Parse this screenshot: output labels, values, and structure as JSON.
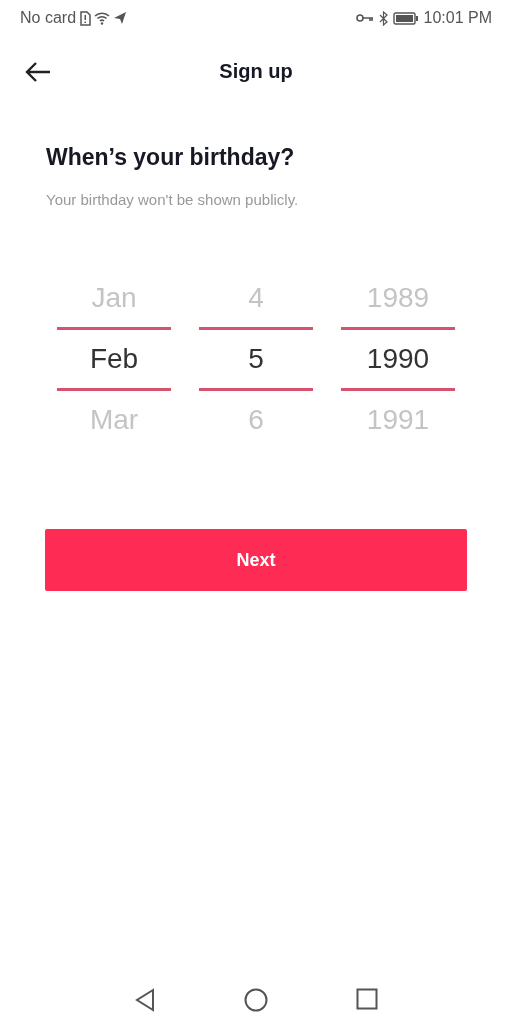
{
  "status_bar": {
    "carrier": "No card",
    "time": "10:01 PM"
  },
  "header": {
    "title": "Sign up"
  },
  "heading": "When’s your birthday?",
  "subtitle": "Your birthday won't be shown publicly.",
  "pickers": [
    {
      "items": [
        {
          "label": "Jan",
          "selected": false
        },
        {
          "label": "Feb",
          "selected": true
        },
        {
          "label": "Mar",
          "selected": false
        }
      ]
    },
    {
      "items": [
        {
          "label": "4",
          "selected": false
        },
        {
          "label": "5",
          "selected": true
        },
        {
          "label": "6",
          "selected": false
        }
      ]
    },
    {
      "items": [
        {
          "label": "1989",
          "selected": false
        },
        {
          "label": "1990",
          "selected": true
        },
        {
          "label": "1991",
          "selected": false
        }
      ]
    }
  ],
  "next_button": "Next"
}
